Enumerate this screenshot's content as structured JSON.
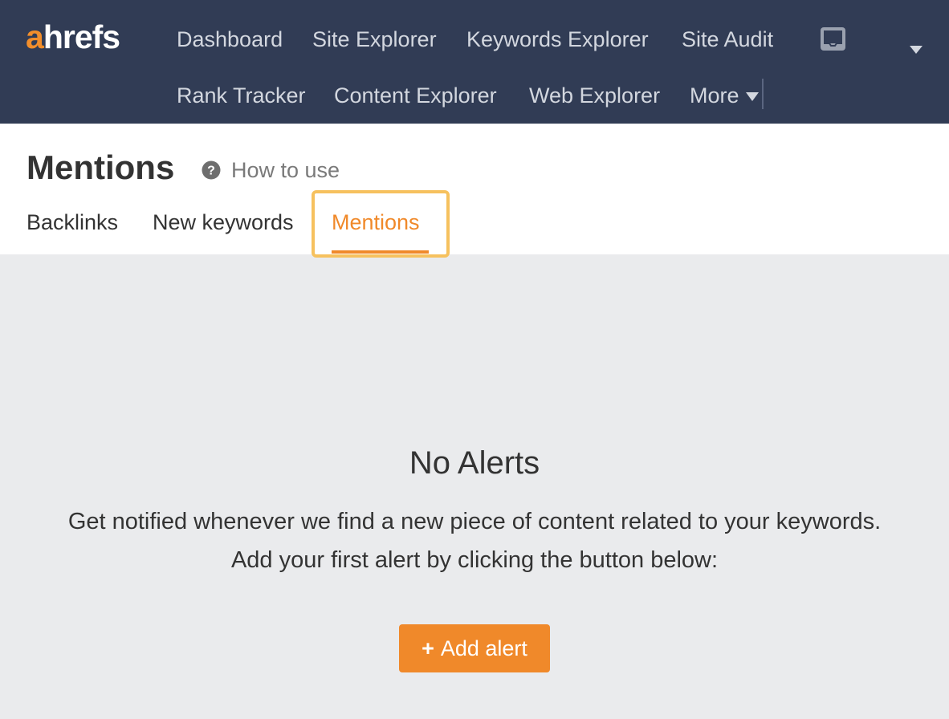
{
  "brand": {
    "logo_first": "a",
    "logo_rest": "hrefs",
    "accent_color": "#f28e2b",
    "topbar_color": "#313c55"
  },
  "nav": {
    "row1": [
      "Dashboard",
      "Site Explorer",
      "Keywords Explorer",
      "Site Audit"
    ],
    "row2": [
      "Rank Tracker",
      "Content Explorer",
      "Web Explorer"
    ],
    "more_label": "More"
  },
  "icons": {
    "inbox": "inbox-icon",
    "account_menu": "chevron-down-icon",
    "help": "question-circle-icon",
    "add": "plus-icon"
  },
  "page": {
    "title": "Mentions",
    "how_to_use": "How to use",
    "tabs": [
      "Backlinks",
      "New keywords",
      "Mentions"
    ],
    "active_tab": "Mentions"
  },
  "empty_state": {
    "title": "No Alerts",
    "line1": "Get notified whenever we find a new piece of content related to your keywords.",
    "line2": "Add your first alert by clicking the button below:",
    "button_plus": "+",
    "button_label": "Add alert"
  }
}
